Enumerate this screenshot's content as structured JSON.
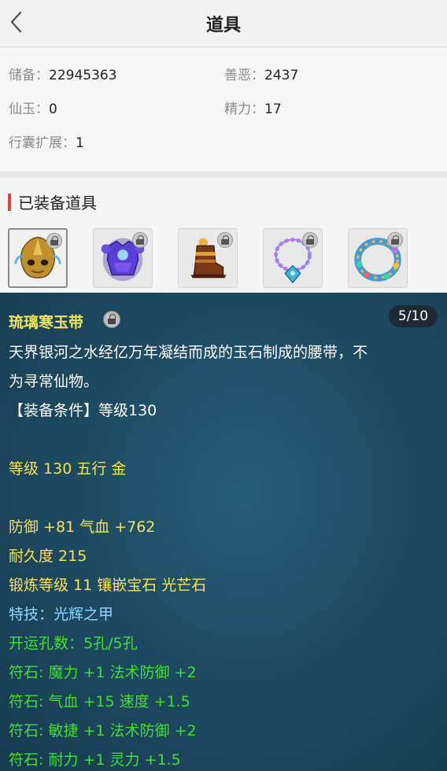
{
  "header": {
    "title": "道具",
    "back_icon": "chevron-left-icon"
  },
  "stats": {
    "reserve_label": "储备：",
    "reserve_value": "22945363",
    "karma_label": "善恶：",
    "karma_value": "2437",
    "jade_label": "仙玉：",
    "jade_value": "0",
    "energy_label": "精力：",
    "energy_value": "17",
    "bag_label": "行囊扩展：",
    "bag_value": "1"
  },
  "equipped": {
    "title": "已装备道具",
    "items": [
      {
        "icon": "helmet-icon",
        "selected": true
      },
      {
        "icon": "armor-icon",
        "selected": false
      },
      {
        "icon": "boots-icon",
        "selected": false
      },
      {
        "icon": "necklace-icon",
        "selected": false
      },
      {
        "icon": "belt-icon",
        "selected": false
      }
    ]
  },
  "detail": {
    "name": "琉璃寒玉带",
    "page": "5/10",
    "desc_line1": "天界银河之水经亿万年凝结而成的玉石制成的腰带，不",
    "desc_line2": "为寻常仙物。",
    "requirement": "【装备条件】等级130",
    "level_line": "等级 130 五行 金",
    "stat_line1": "防御 +81 气血 +762",
    "stat_line2": "耐久度 215",
    "stat_line3": "锻炼等级 11 镶嵌宝石 光芒石",
    "skill_line": "特技：光辉之甲",
    "holes_line": "开运孔数：5孔/5孔",
    "rune_lines": [
      "符石: 魔力 +1 法术防御 +2",
      "符石: 气血 +15 速度 +1.5",
      "符石: 敏捷 +1 法术防御 +2",
      "符石: 耐力 +1 灵力 +1.5"
    ]
  },
  "colors": {
    "accent_bar": "#d9473f",
    "name_yellow": "#f5e35c",
    "skill_blue": "#8fd6ff",
    "rune_green": "#3fe02f",
    "panel_bg": "#1e4c63"
  }
}
